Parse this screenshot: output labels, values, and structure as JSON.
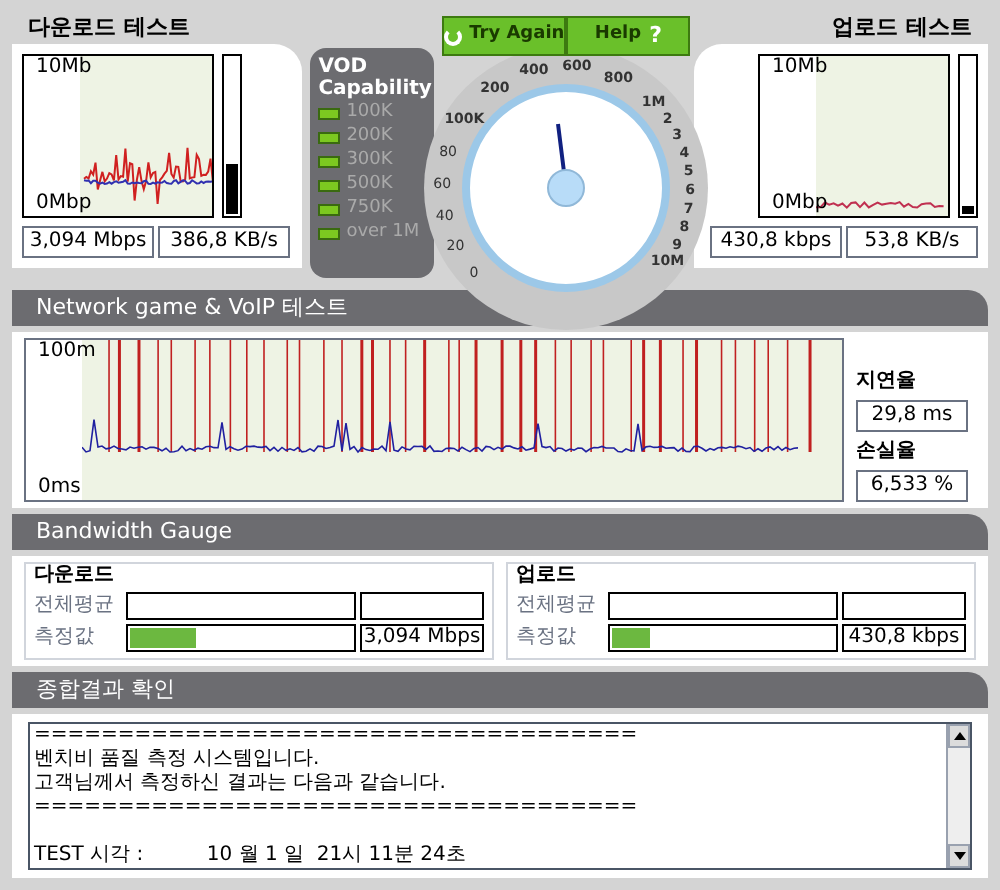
{
  "download": {
    "title": "다운로드 테스트",
    "axis_top": "10Mb",
    "axis_bottom": "0Mbp",
    "level": 0.32,
    "speed": "3,094 Mbps",
    "rate": "386,8 KB/s"
  },
  "vod": {
    "title": "VOD Capability",
    "items": [
      {
        "label": "100K",
        "lit": true
      },
      {
        "label": "200K",
        "lit": true
      },
      {
        "label": "300K",
        "lit": true
      },
      {
        "label": "500K",
        "lit": true
      },
      {
        "label": "750K",
        "lit": true
      },
      {
        "label": "over 1M",
        "lit": true
      }
    ]
  },
  "buttons": [
    {
      "label": "Try Again",
      "kind": "retry"
    },
    {
      "label": "Help",
      "kind": "help",
      "icon": "?"
    }
  ],
  "dial": {
    "labels": [
      "100K",
      "200",
      "400",
      "600",
      "800",
      "1M",
      "2",
      "3",
      "4",
      "5",
      "6",
      "7",
      "8",
      "9",
      "10M"
    ],
    "left_labels": [
      "80",
      "60",
      "40",
      "20",
      "0"
    ]
  },
  "upload": {
    "title": "업로드 테스트",
    "axis_top": "10Mb",
    "axis_bottom": "0Mbp",
    "level": 0.05,
    "speed": "430,8 kbps",
    "rate": "53,8 KB/s"
  },
  "network": {
    "title": "Network game & VoIP 테스트",
    "axis_top": "100m",
    "axis_bottom": "0ms",
    "latency_label": "지연율",
    "latency": "29,8 ms",
    "loss_label": "손실율",
    "loss": "6,533 %"
  },
  "bandwidth": {
    "title": "Bandwidth Gauge",
    "groups": [
      {
        "title": "다운로드",
        "avg_label": "전체평균",
        "measured_label": "측정값",
        "level": 0.3,
        "value": "3,094 Mbps"
      },
      {
        "title": "업로드",
        "avg_label": "전체평균",
        "measured_label": "측정값",
        "level": 0.17,
        "value": "430,8 kbps"
      }
    ]
  },
  "summary": {
    "title": "종합결과 확인",
    "lines": [
      "====================================",
      "벤치비 품질 측정 시스템입니다.",
      "고객님께서 측정하신 결과는 다음과 같습니다.",
      "====================================",
      "TEST 시각 :          10 월 1 일  21시 11분 24초"
    ]
  }
}
